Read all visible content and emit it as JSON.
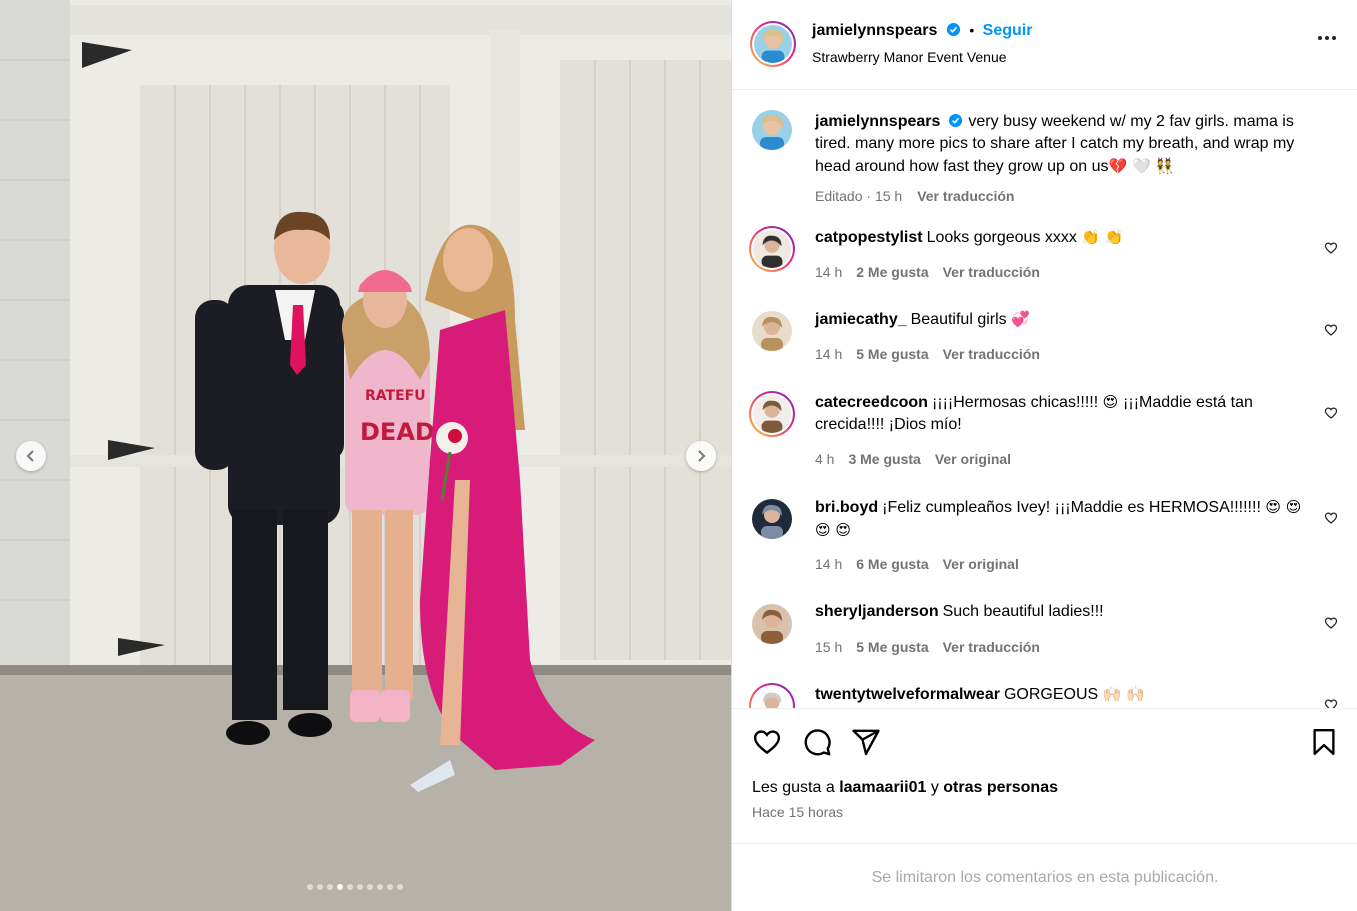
{
  "post": {
    "username": "jamielynnspears",
    "follow_label": "Seguir",
    "location": "Strawberry Manor Event Venue",
    "caption_text": "very busy weekend w/ my 2 fav girls. mama is tired. many more pics to share after I catch my breath, and wrap my head around how fast they grow up on us",
    "caption_emoji": "💔 🤍 👯",
    "edited_label": "Editado",
    "edited_time": "15 h",
    "translate_label": "Ver traducción",
    "slide_count": 10,
    "active_slide": 4
  },
  "comments": [
    {
      "username": "catpopestylist",
      "text": "Looks gorgeous xxxx",
      "emoji": "👏 👏",
      "time": "14 h",
      "likes": "2 Me gusta",
      "action": "Ver traducción",
      "story_ring": true
    },
    {
      "username": "jamiecathy_",
      "text": "Beautiful girls",
      "emoji": "💞",
      "time": "14 h",
      "likes": "5 Me gusta",
      "action": "Ver traducción",
      "story_ring": false
    },
    {
      "username": "catecreedcoon",
      "text": "¡¡¡¡Hermosas chicas!!!!!",
      "emoji": "😍",
      "text2": "¡¡¡Maddie está tan crecida!!!! ¡Dios mío!",
      "time": "4 h",
      "likes": "3 Me gusta",
      "action": "Ver original",
      "story_ring": true
    },
    {
      "username": "bri.boyd",
      "text": "¡Feliz cumpleaños Ivey! ¡¡¡Maddie es HERMOSA!!!!!!!",
      "emoji": "😍 😍 😍 😍",
      "time": "14 h",
      "likes": "6 Me gusta",
      "action": "Ver original",
      "story_ring": false
    },
    {
      "username": "sheryljanderson",
      "text": "Such beautiful ladies!!!",
      "time": "15 h",
      "likes": "5 Me gusta",
      "action": "Ver traducción",
      "story_ring": false
    },
    {
      "username": "twentytwelveformalwear",
      "text": "GORGEOUS",
      "emoji": "🙌🏻 🙌🏻",
      "story_ring": true
    }
  ],
  "likes": {
    "prefix": "Les gusta a",
    "user": "laamaarii01",
    "joiner": "y",
    "others": "otras personas"
  },
  "posted_ago": "Hace 15 horas",
  "comments_limited": "Se limitaron los comentarios en esta publicación.",
  "icons": {
    "like": "heart-icon",
    "comment": "comment-icon",
    "share": "share-icon",
    "save": "bookmark-icon",
    "more": "more-icon",
    "verified": "verified-icon"
  },
  "colors": {
    "accent": "#0095f6",
    "muted": "#737373",
    "verified": "#0095f6"
  }
}
